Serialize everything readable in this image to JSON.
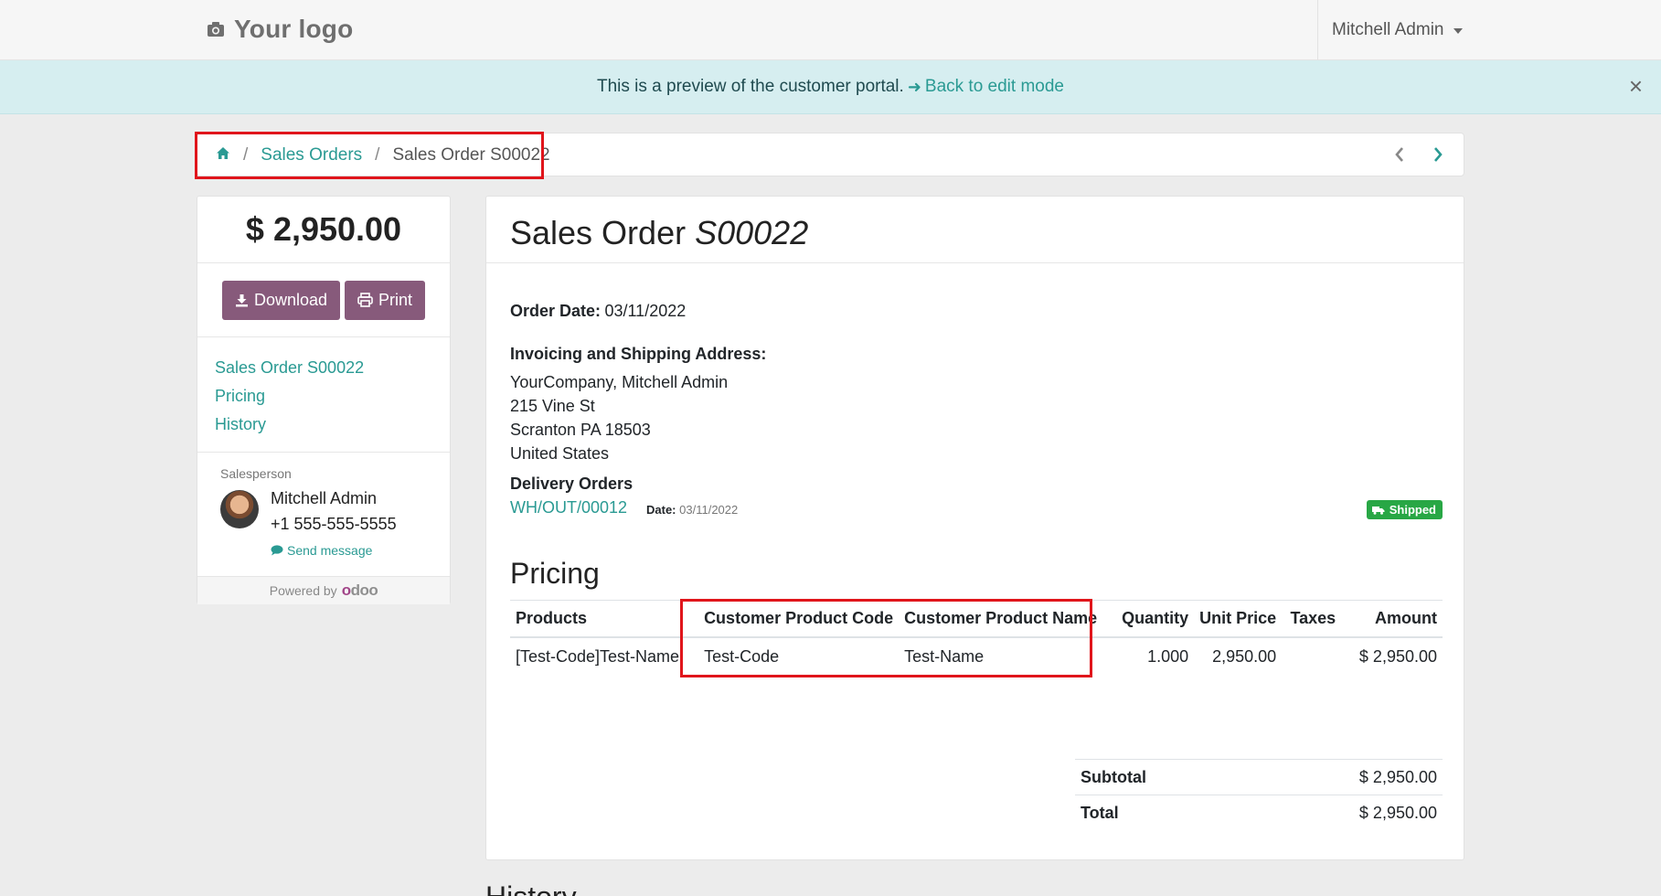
{
  "header": {
    "logo_text": "Your logo",
    "user_name": "Mitchell Admin"
  },
  "banner": {
    "message": "This is a preview of the customer portal.",
    "link": "Back to edit mode"
  },
  "breadcrumb": {
    "items": [
      "Sales Orders",
      "Sales Order S00022"
    ]
  },
  "sidebar": {
    "total": "$ 2,950.00",
    "download_label": "Download",
    "print_label": "Print",
    "nav": [
      "Sales Order S00022",
      "Pricing",
      "History"
    ],
    "salesperson_label": "Salesperson",
    "salesperson_name": "Mitchell Admin",
    "salesperson_phone": "+1 555-555-5555",
    "send_message": "Send message",
    "powered_by": "Powered by",
    "powered_brand_first": "o",
    "powered_brand_rest": "doo"
  },
  "order": {
    "title_prefix": "Sales Order",
    "title_ref": "S00022",
    "order_date_label": "Order Date:",
    "order_date": "03/11/2022",
    "address_label": "Invoicing and Shipping Address:",
    "address_lines": [
      "YourCompany, Mitchell Admin",
      "215 Vine St",
      "Scranton PA 18503",
      "United States"
    ],
    "delivery_label": "Delivery Orders",
    "delivery_ref": "WH/OUT/00012",
    "delivery_date_label": "Date:",
    "delivery_date": "03/11/2022",
    "delivery_status": "Shipped"
  },
  "pricing": {
    "heading": "Pricing",
    "columns": [
      "Products",
      "Customer Product Code",
      "Customer Product Name",
      "Quantity",
      "Unit Price",
      "Taxes",
      "Amount"
    ],
    "rows": [
      [
        "[Test-Code]Test-Name",
        "Test-Code",
        "Test-Name",
        "1.000",
        "2,950.00",
        "",
        "$ 2,950.00"
      ]
    ],
    "subtotal_label": "Subtotal",
    "subtotal": "$ 2,950.00",
    "total_label": "Total",
    "total": "$ 2,950.00"
  },
  "history_heading": "History",
  "colors": {
    "accent": "#2a9a93",
    "brand_button": "#875a7b",
    "highlight_box": "#e0151b",
    "banner_bg": "#d6eef0",
    "shipped_badge": "#28a745"
  }
}
